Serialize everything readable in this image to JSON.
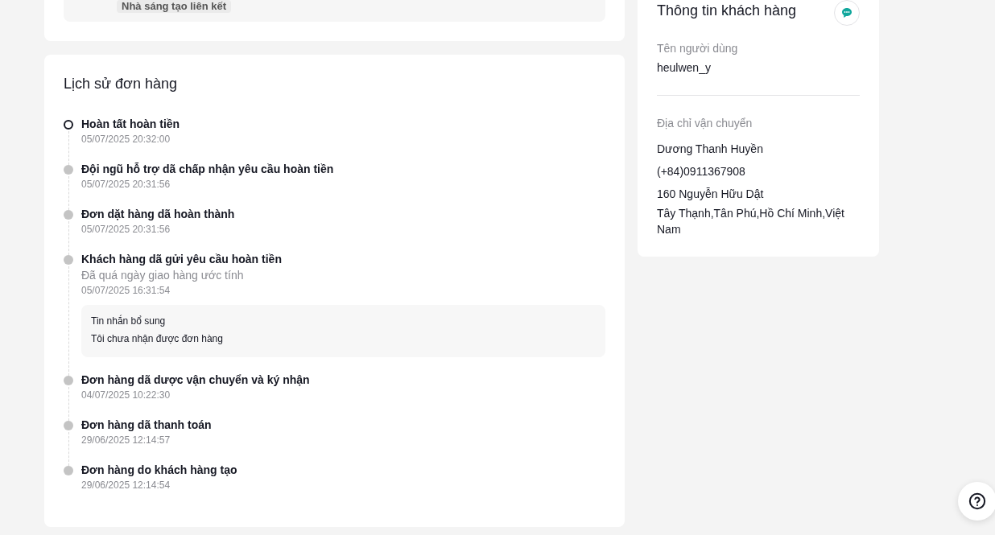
{
  "affiliate_card": {
    "tag": "Nhà sáng tạo liên kết"
  },
  "order_history": {
    "title": "Lịch sử đơn hàng",
    "events": [
      {
        "title": "Hoàn tất hoàn tiền",
        "time": "05/07/2025 20:32:00",
        "current": true
      },
      {
        "title": "Đội ngũ hỗ trợ dã chấp nhận yêu cầu hoàn tiền",
        "time": "05/07/2025 20:31:56",
        "current": false
      },
      {
        "title": "Đơn dặt hàng dã hoàn thành",
        "time": "05/07/2025 20:31:56",
        "current": false
      },
      {
        "title": "Khách hàng dã gửi yêu cầu hoàn tiền",
        "subtitle": "Đã quá ngày giao hàng ước tính",
        "time": "05/07/2025 16:31:54",
        "current": false,
        "message": {
          "label": "Tin nhắn bổ sung",
          "text": "Tôi chưa nhận được đơn hàng"
        }
      },
      {
        "title": "Đơn hàng dã dược vận chuyển và ký nhận",
        "time": "04/07/2025 10:22:30",
        "current": false
      },
      {
        "title": "Đơn hàng dã thanh toán",
        "time": "29/06/2025 12:14:57",
        "current": false
      },
      {
        "title": "Đơn hàng do khách hàng tạo",
        "time": "29/06/2025 12:14:54",
        "current": false
      }
    ]
  },
  "customer_info": {
    "title": "Thông tin khách hàng",
    "username_label": "Tên người dùng",
    "username": "heulwen_y",
    "shipping_label": "Địa chỉ vận chuyển",
    "recipient": "Dương Thanh Huyền",
    "phone": "(+84)0911367908",
    "address_line": "160 Nguyễn Hữu Dật",
    "address_region": "Tây Thạnh,Tân Phú,Hồ Chí Minh,Việt Nam"
  }
}
